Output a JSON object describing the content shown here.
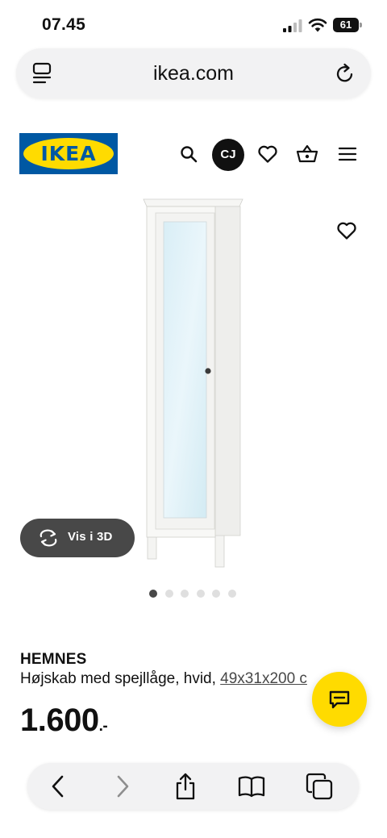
{
  "status_bar": {
    "time": "07.45",
    "battery_level": "61"
  },
  "browser": {
    "url": "ikea.com",
    "tabs_icon": "tab-overview-icon",
    "reload_icon": "reload-icon"
  },
  "header": {
    "logo_text": "IKEA",
    "avatar_initials": "CJ",
    "icons": [
      "search-icon",
      "avatar",
      "heart-icon",
      "basket-icon",
      "menu-icon"
    ]
  },
  "gallery": {
    "view_3d_label": "Vis i 3D",
    "image_count": 6,
    "active_index": 0
  },
  "product": {
    "name": "HEMNES",
    "description_prefix": "Højskab med spejllåge, hvid, ",
    "size_link": "49x31x200 c",
    "price": "1.600",
    "price_suffix": ".-"
  },
  "bottom_bar": {
    "icons": [
      "back-icon",
      "forward-icon",
      "share-icon",
      "bookmarks-icon",
      "tabs-icon"
    ]
  },
  "colors": {
    "ikea_blue": "#0058a3",
    "ikea_yellow": "#ffdb00",
    "dark_grey": "#484848"
  }
}
